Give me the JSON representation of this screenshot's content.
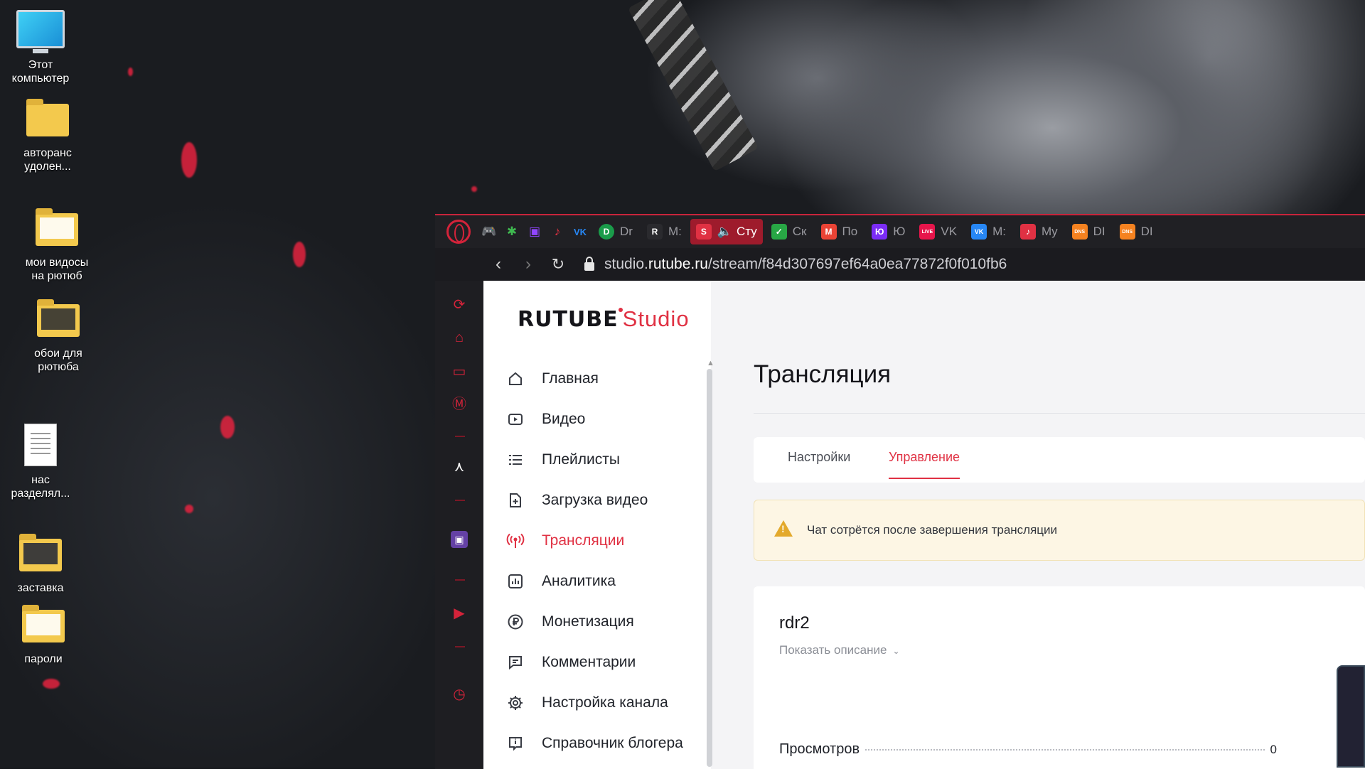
{
  "desktop": {
    "icons": [
      {
        "label": "Этот компьютер",
        "kind": "monitor-icon"
      },
      {
        "label": "авторанс удолен...",
        "kind": "folder-icon"
      },
      {
        "label": "мои видосы на рютюб",
        "kind": "folder-icon"
      },
      {
        "label": "обои для рютюба",
        "kind": "folder-icon"
      },
      {
        "label": "нас разделял...",
        "kind": "document-icon"
      },
      {
        "label": "заставка",
        "kind": "folder-icon"
      },
      {
        "label": "пароли",
        "kind": "folder-icon"
      }
    ]
  },
  "browser": {
    "tabs": [
      {
        "label": "Dr",
        "favicon": "D",
        "color": "#1a9c4a"
      },
      {
        "label": "M:",
        "favicon": "R",
        "color": "#2a2a2e"
      },
      {
        "label": "Сту",
        "favicon": "S",
        "color": "#e03143",
        "active": true,
        "audio": true
      },
      {
        "label": "Ск",
        "favicon": "✓",
        "color": "#28a745"
      },
      {
        "label": "По",
        "favicon": "M",
        "color": "#ea4335"
      },
      {
        "label": "Ю",
        "favicon": "Ю",
        "color": "#7b2cf5"
      },
      {
        "label": "VK",
        "favicon": "LIVE",
        "color": "#e6154b"
      },
      {
        "label": "M:",
        "favicon": "VK",
        "color": "#2787f5"
      },
      {
        "label": "My",
        "favicon": "♪",
        "color": "#e03143"
      },
      {
        "label": "DI",
        "favicon": "DNS",
        "color": "#f58220"
      },
      {
        "label": "DI",
        "favicon": "DNS",
        "color": "#f58220"
      }
    ],
    "url_prefix": "studio.",
    "url_domain": "rutube.ru",
    "url_path": "/stream/f84d307697ef64a0ea77872f0f010fb6"
  },
  "studio": {
    "logo_main": "RUTUBE",
    "logo_sub": "Studio",
    "nav": [
      {
        "label": "Главная",
        "icon": "home-icon"
      },
      {
        "label": "Видео",
        "icon": "video-icon"
      },
      {
        "label": "Плейлисты",
        "icon": "playlist-icon"
      },
      {
        "label": "Загрузка видео",
        "icon": "upload-icon"
      },
      {
        "label": "Трансляции",
        "icon": "broadcast-icon",
        "active": true
      },
      {
        "label": "Аналитика",
        "icon": "analytics-icon"
      },
      {
        "label": "Монетизация",
        "icon": "ruble-icon"
      },
      {
        "label": "Комментарии",
        "icon": "comment-icon"
      },
      {
        "label": "Настройка канала",
        "icon": "gear-icon"
      },
      {
        "label": "Справочник блогера",
        "icon": "info-icon"
      }
    ],
    "page_title": "Трансляция",
    "subtabs": {
      "settings": "Настройки",
      "manage": "Управление"
    },
    "alert": "Чат сотрётся после завершения трансляции",
    "stream": {
      "name": "rdr2",
      "show_description": "Показать описание",
      "views_label": "Просмотров",
      "views_value": "0"
    },
    "accent": "#e03143"
  }
}
